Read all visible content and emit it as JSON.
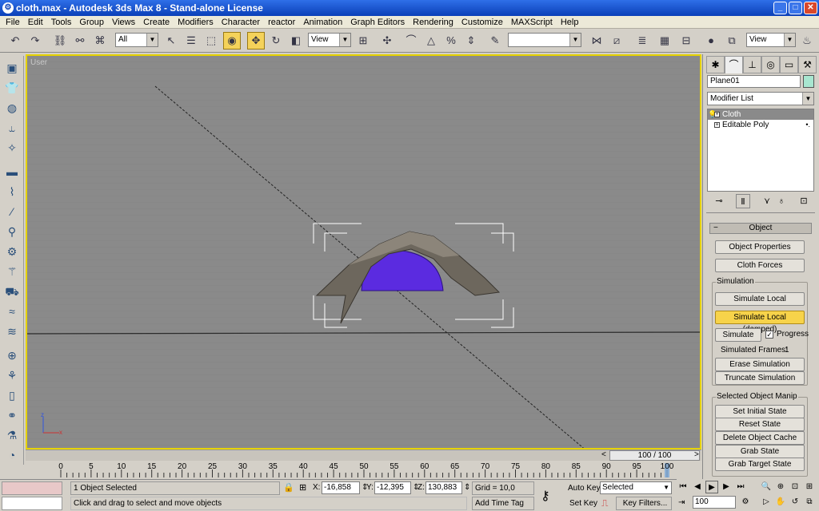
{
  "window": {
    "title": "cloth.max - Autodesk 3ds Max 8  - Stand-alone License",
    "minimize": "_",
    "maximize": "□",
    "close": "✕"
  },
  "menu": [
    "File",
    "Edit",
    "Tools",
    "Group",
    "Views",
    "Create",
    "Modifiers",
    "Character",
    "reactor",
    "Animation",
    "Graph Editors",
    "Rendering",
    "Customize",
    "MAXScript",
    "Help"
  ],
  "toolbar": {
    "selection_filter": "All",
    "ref_coord": "View",
    "named_selection": "",
    "viewport_combo": "View"
  },
  "viewport": {
    "label": "User",
    "axis_z": "z",
    "axis_x": "x",
    "cloth_color": "#5b2be0"
  },
  "timeslider": {
    "label": "100 / 100",
    "prev": "<",
    "next": ">"
  },
  "ruler": {
    "ticks": [
      0,
      5,
      10,
      15,
      20,
      25,
      30,
      35,
      40,
      45,
      50,
      55,
      60,
      65,
      70,
      75,
      80,
      85,
      90,
      95,
      100
    ],
    "current": 100
  },
  "command_panel": {
    "object_name": "Plane01",
    "modifier_list": "Modifier List",
    "stack": [
      {
        "label": "Cloth",
        "selected": true
      },
      {
        "label": "Editable Poly",
        "selected": false
      }
    ],
    "object_rollout": "Object",
    "buttons": {
      "object_properties": "Object Properties",
      "cloth_forces": "Cloth Forces",
      "simulate_local": "Simulate Local",
      "simulate_local_damped": "Simulate Local (damped)",
      "simulate": "Simulate",
      "erase_simulation": "Erase Simulation",
      "truncate_simulation": "Truncate Simulation",
      "set_initial_state": "Set Initial State",
      "reset_state": "Reset State",
      "delete_object_cache": "Delete Object Cache",
      "grab_state": "Grab State",
      "grab_target_state": "Grab Target State"
    },
    "simulation_group": "Simulation",
    "progress_label": "Progress",
    "progress_checked": true,
    "simulated_frames_label": "Simulated Frames:",
    "simulated_frames": "1",
    "manip_group": "Selected Object Manip"
  },
  "status": {
    "selected": "1 Object Selected",
    "prompt": "Click and drag to select and move objects",
    "x_label": "X:",
    "x": "-16,858",
    "y_label": "Y:",
    "y": "-12,395",
    "z_label": "Z:",
    "z": "130,883",
    "grid": "Grid = 10,0",
    "add_time_tag": "Add Time Tag",
    "auto_key": "Auto Key",
    "set_key": "Set Key",
    "key_mode": "Selected",
    "key_filters": "Key Filters...",
    "frame": "100"
  }
}
